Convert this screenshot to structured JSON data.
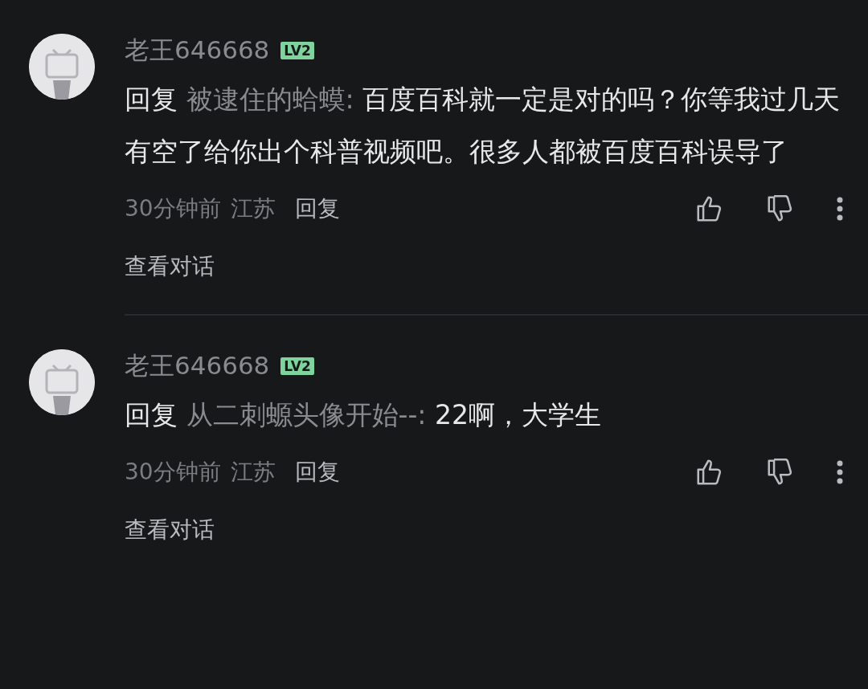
{
  "comments": [
    {
      "username": "老王646668",
      "level": "LV2",
      "reply_label": "回复",
      "reply_to": "被逮住的蛤蟆:",
      "text": "百度百科就一定是对的吗？你等我过几天有空了给你出个科普视频吧。很多人都被百度百科误导了",
      "time": "30分钟前",
      "location": "江苏",
      "reply_button": "回复",
      "view_conversation": "查看对话"
    },
    {
      "username": "老王646668",
      "level": "LV2",
      "reply_label": "回复",
      "reply_to": "从二刺螈头像开始--:",
      "text": "22啊，大学生",
      "time": "30分钟前",
      "location": "江苏",
      "reply_button": "回复",
      "view_conversation": "查看对话"
    }
  ]
}
